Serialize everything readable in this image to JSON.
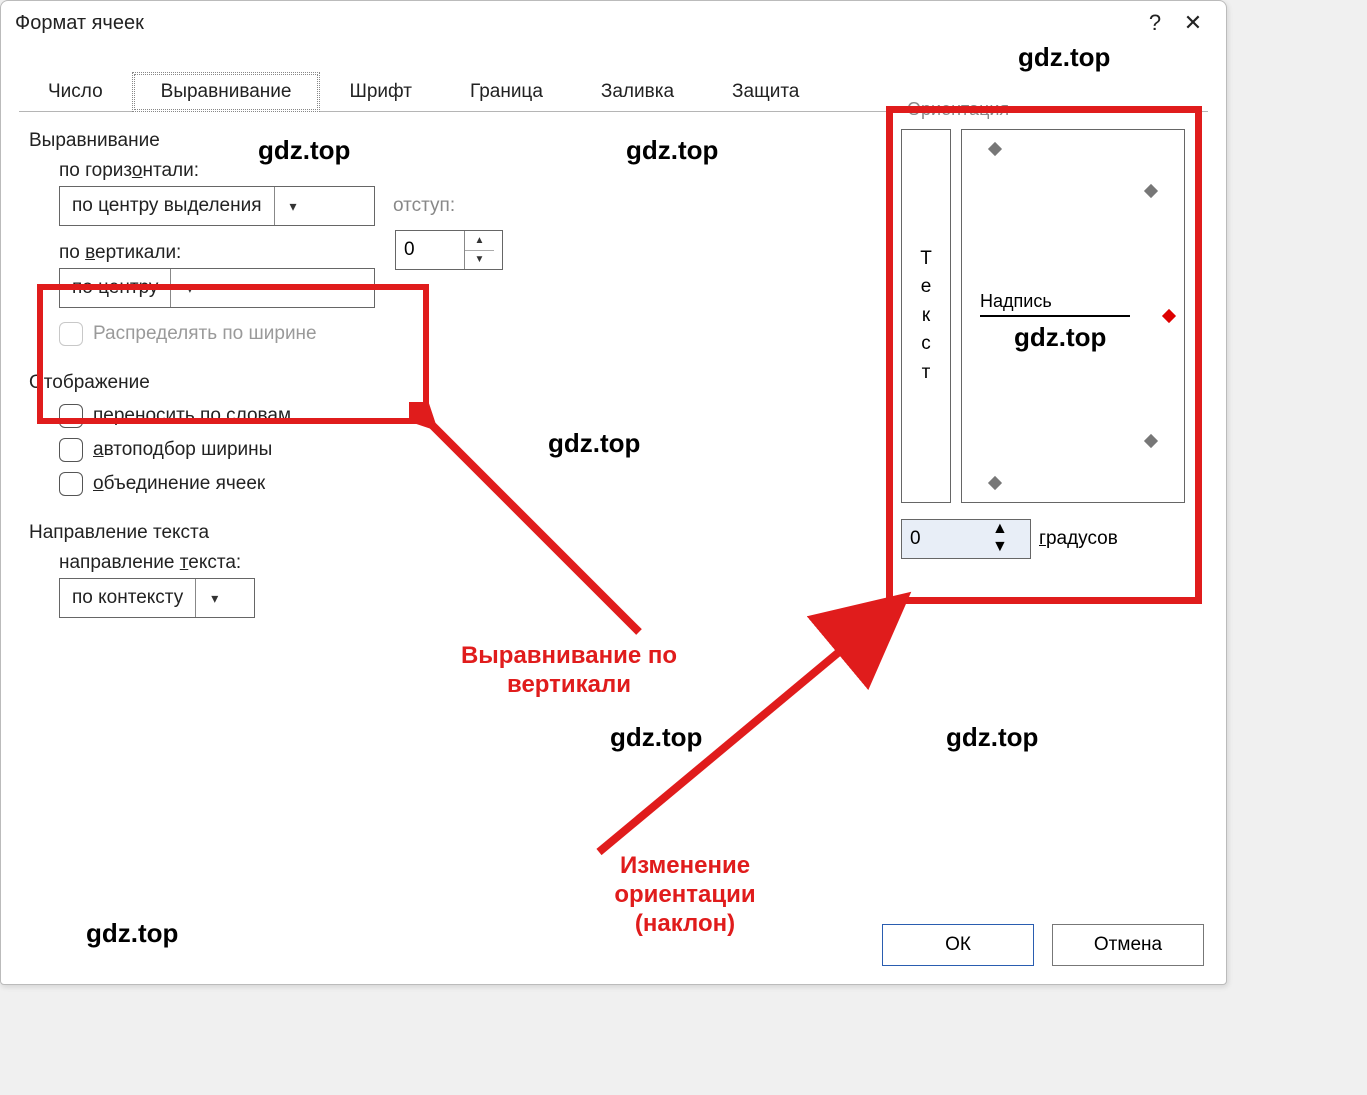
{
  "title": "Формат ячеек",
  "tabs": [
    "Число",
    "Выравнивание",
    "Шрифт",
    "Граница",
    "Заливка",
    "Защита"
  ],
  "active_tab_index": 1,
  "alignment": {
    "group_label": "Выравнивание",
    "horiz_label": "по горизонтали:",
    "horiz_value": "по центру выделения",
    "indent_label": "отступ:",
    "indent_value": "0",
    "vert_label": "по вертикали:",
    "vert_value": "по центру",
    "distribute_label": "Распределять по ширине"
  },
  "display": {
    "group_label": "Отображение",
    "wrap_label": "переносить по словам",
    "shrink_label": "автоподбор ширины",
    "merge_label": "объединение ячеек"
  },
  "direction": {
    "group_label": "Направление текста",
    "dir_label": "направление текста:",
    "dir_value": "по контексту"
  },
  "orientation": {
    "group_label": "Ориентация",
    "vtext": "Текст",
    "dial_word": "Надпись",
    "degrees_value": "0",
    "degrees_label": "градусов"
  },
  "annotations": {
    "val_vert": "Выравнивание по\nвертикали",
    "orient_change": "Изменение\nориентации\n(наклон)"
  },
  "watermarks": [
    "gdz.top",
    "gdz.top",
    "gdz.top",
    "gdz.top",
    "gdz.top",
    "gdz.top",
    "gdz.top"
  ],
  "buttons": {
    "ok": "ОК",
    "cancel": "Отмена"
  },
  "help_icon": "?",
  "close_icon": "✕"
}
